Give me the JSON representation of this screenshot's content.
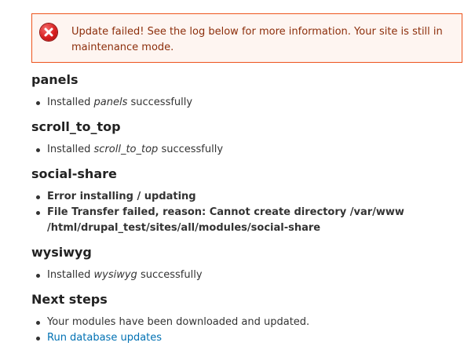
{
  "message": {
    "type": "error",
    "icon": "error-x-icon",
    "text": "Update failed! See the log below for more information. Your site is still in maintenance mode."
  },
  "modules": [
    {
      "name": "panels",
      "result": {
        "prefix": "Installed ",
        "module": "panels",
        "suffix": " successfully"
      }
    },
    {
      "name": "scroll_to_top",
      "result": {
        "prefix": "Installed ",
        "module": "scroll_to_top",
        "suffix": " successfully"
      }
    },
    {
      "name": "social-share",
      "errors": [
        "Error installing / updating",
        "File Transfer failed, reason: Cannot create directory /var/www /html/drupal_test/sites/all/modules/social-share"
      ]
    },
    {
      "name": "wysiwyg",
      "result": {
        "prefix": "Installed ",
        "module": "wysiwyg",
        "suffix": " successfully"
      }
    }
  ],
  "next_steps": {
    "title": "Next steps",
    "items": [
      "Your modules have been downloaded and updated."
    ],
    "link_label": "Run database updates"
  },
  "colors": {
    "error_border": "#ed541d",
    "error_background": "#fef5f1",
    "error_text": "#8c2e0b",
    "link": "#0071b3"
  }
}
